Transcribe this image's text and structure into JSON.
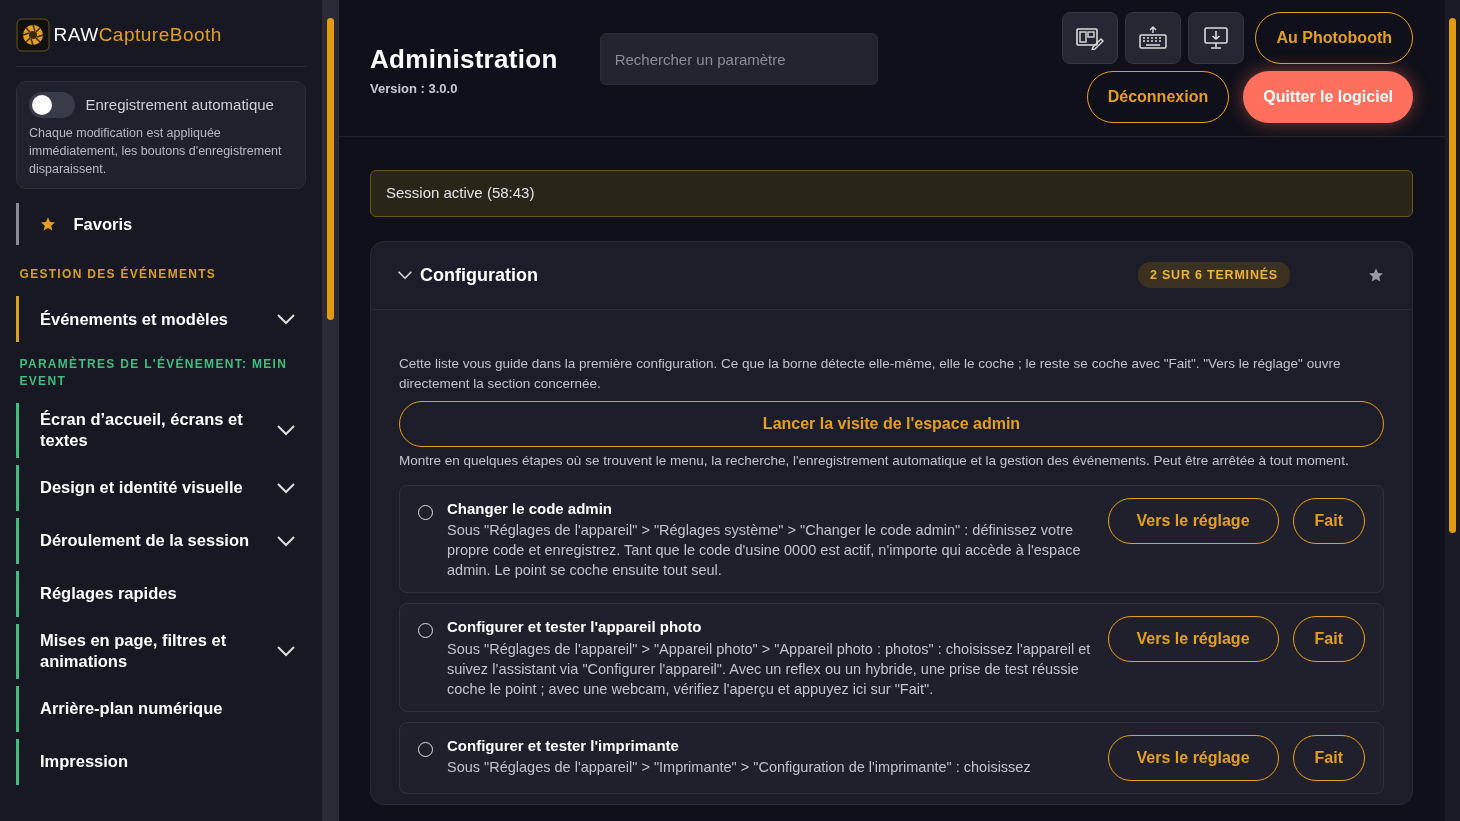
{
  "sidebar": {
    "logo": {
      "prefix": "RAW",
      "suffix": "CaptureBooth"
    },
    "autosave": {
      "label": "Enregistrement automatique",
      "on": false,
      "description": "Chaque modification est appliquée immédiatement, les boutons d'enregistrement disparaissent."
    },
    "favorites": {
      "label": "Favoris"
    },
    "sections": [
      {
        "title": "GESTION DES ÉVÉNEMENTS",
        "color": "#d9a21b",
        "items": [
          {
            "label": "Événements et modèles",
            "expandable": true
          }
        ]
      },
      {
        "title": "PARAMÈTRES DE L'ÉVÉNEMENT: MEIN EVENT",
        "color": "#3fbf7f",
        "items": [
          {
            "label": "Écran d’accueil, écrans et textes",
            "expandable": true
          },
          {
            "label": "Design et identité visuelle",
            "expandable": true
          },
          {
            "label": "Déroulement de la session",
            "expandable": true
          },
          {
            "label": "Réglages rapides",
            "expandable": false
          },
          {
            "label": "Mises en page, filtres et animations",
            "expandable": true
          },
          {
            "label": "Arrière-plan numérique",
            "expandable": false
          },
          {
            "label": "Impression",
            "expandable": false
          }
        ]
      }
    ]
  },
  "header": {
    "title": "Administration",
    "version": "Version : 3.0.0",
    "search": {
      "placeholder": "Rechercher un paramètre"
    },
    "icon_buttons": [
      {
        "kind": "layout"
      },
      {
        "kind": "keyboard"
      },
      {
        "kind": "monitor"
      }
    ],
    "buttons": [
      {
        "label": "Au Photobooth",
        "kind": "outline"
      },
      {
        "label": "Déconnexion",
        "kind": "outline"
      },
      {
        "label": "Quitter le logiciel",
        "kind": "danger"
      }
    ]
  },
  "session": "Session active (58:43)",
  "config": {
    "title": "Configuration",
    "expanded": true,
    "badge": "2 SUR 6 TERMINÉS",
    "favorite": false,
    "intro": "Cette liste vous guide dans la première configuration. Ce que la borne détecte elle-même, elle le coche ; le reste se coche avec \"Fait\". \"Vers le réglage\" ouvre directement la section concernée.",
    "tour_button": "Lancer la visite de l'espace admin",
    "tour_note": "Montre en quelques étapes où se trouvent le menu, la recherche, l'enregistrement automatique et la gestion des événements. Peut être arrêtée à tout moment.",
    "steps": [
      {
        "title": "Changer le code admin",
        "done": false,
        "text": "Sous \"Réglages de l'appareil\" > \"Réglages système\" > \"Changer le code admin\" : définissez votre propre code et enregistrez. Tant que le code d'usine 0000 est actif, n'importe qui accède à l'espace admin. Le point se coche ensuite tout seul.",
        "goto": "Vers le réglage",
        "done_button": "Fait"
      },
      {
        "title": "Configurer et tester l'appareil photo",
        "done": false,
        "text": "Sous \"Réglages de l'appareil\" > \"Appareil photo\" > \"Appareil photo : photos\" : choisissez l'appareil et suivez l’assistant via \"Configurer l'appareil\". Avec un reflex ou un hybride, une prise de test réussie coche le point ; avec une webcam, vérifiez l'aperçu et appuyez ici sur \"Fait\".",
        "goto": "Vers le réglage",
        "done_button": "Fait"
      },
      {
        "title": "Configurer et tester l'imprimante",
        "done": false,
        "text": "Sous \"Réglages de l'appareil\" > \"Imprimante\" > \"Configuration de l'imprimante\" : choisissez",
        "goto": "Vers le réglage",
        "done_button": "Fait"
      }
    ]
  }
}
